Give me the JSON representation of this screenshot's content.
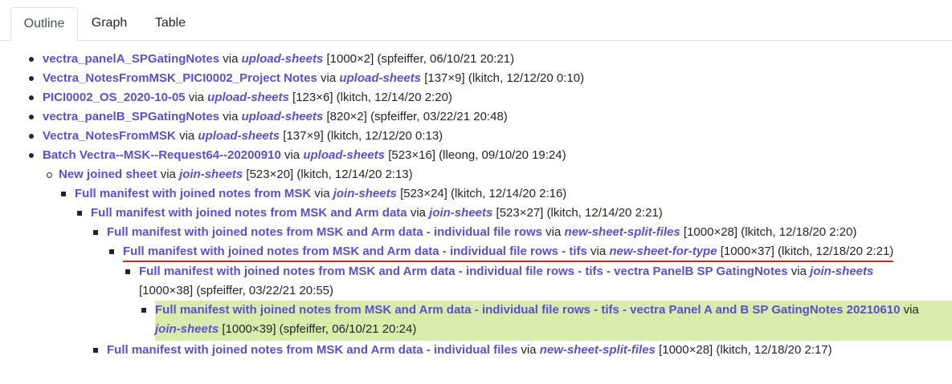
{
  "tabs": {
    "outline": "Outline",
    "graph": "Graph",
    "table": "Table"
  },
  "via_word": "via",
  "rows": [
    {
      "name": "vectra_panelA_SPGatingNotes",
      "action": "upload-sheets",
      "meta": "[1000×2] (spfeiffer, 06/10/21 20:21)"
    },
    {
      "name": "Vectra_NotesFromMSK_PICI0002_Project Notes",
      "action": "upload-sheets",
      "meta": "[137×9] (lkitch, 12/12/20 0:10)"
    },
    {
      "name": "PICI0002_OS_2020-10-05",
      "action": "upload-sheets",
      "meta": "[123×6] (lkitch, 12/14/20 2:20)"
    },
    {
      "name": "vectra_panelB_SPGatingNotes",
      "action": "upload-sheets",
      "meta": "[820×2] (spfeiffer, 03/22/21 20:48)"
    },
    {
      "name": "Vectra_NotesFromMSK",
      "action": "upload-sheets",
      "meta": "[137×9] (lkitch, 12/12/20 0:13)"
    },
    {
      "name": "Batch Vectra--MSK--Request64--20200910",
      "action": "upload-sheets",
      "meta": "[523×16] (lleong, 09/10/20 19:24)"
    },
    {
      "name": "New joined sheet",
      "action": "join-sheets",
      "meta": "[523×20] (lkitch, 12/14/20 2:13)"
    },
    {
      "name": "Full manifest with joined notes from MSK",
      "action": "join-sheets",
      "meta": "[523×24] (lkitch, 12/14/20 2:16)"
    },
    {
      "name": "Full manifest with joined notes from MSK and Arm data",
      "action": "join-sheets",
      "meta": "[523×27] (lkitch, 12/14/20 2:21)"
    },
    {
      "name": "Full manifest with joined notes from MSK and Arm data - individual file rows",
      "action": "new-sheet-split-files",
      "meta": "[1000×28] (lkitch, 12/18/20 2:20)"
    },
    {
      "name": "Full manifest with joined notes from MSK and Arm data - individual file rows - tifs",
      "action": "new-sheet-for-type",
      "meta": "[1000×37] (lkitch, 12/18/20 2:21)"
    },
    {
      "name": "Full manifest with joined notes from MSK and Arm data - individual file rows - tifs - vectra PanelB SP GatingNotes",
      "action": "join-sheets",
      "meta": "[1000×38] (spfeiffer, 03/22/21 20:55)"
    },
    {
      "name": "Full manifest with joined notes from MSK and Arm data - individual file rows - tifs - vectra Panel A and B SP GatingNotes 20210610",
      "action": "join-sheets",
      "meta": "[1000×39] (spfeiffer, 06/10/21 20:24)"
    },
    {
      "name": "Full manifest with joined notes from MSK and Arm data - individual files",
      "action": "new-sheet-split-files",
      "meta": "[1000×28] (lkitch, 12/18/20 2:17)"
    }
  ]
}
